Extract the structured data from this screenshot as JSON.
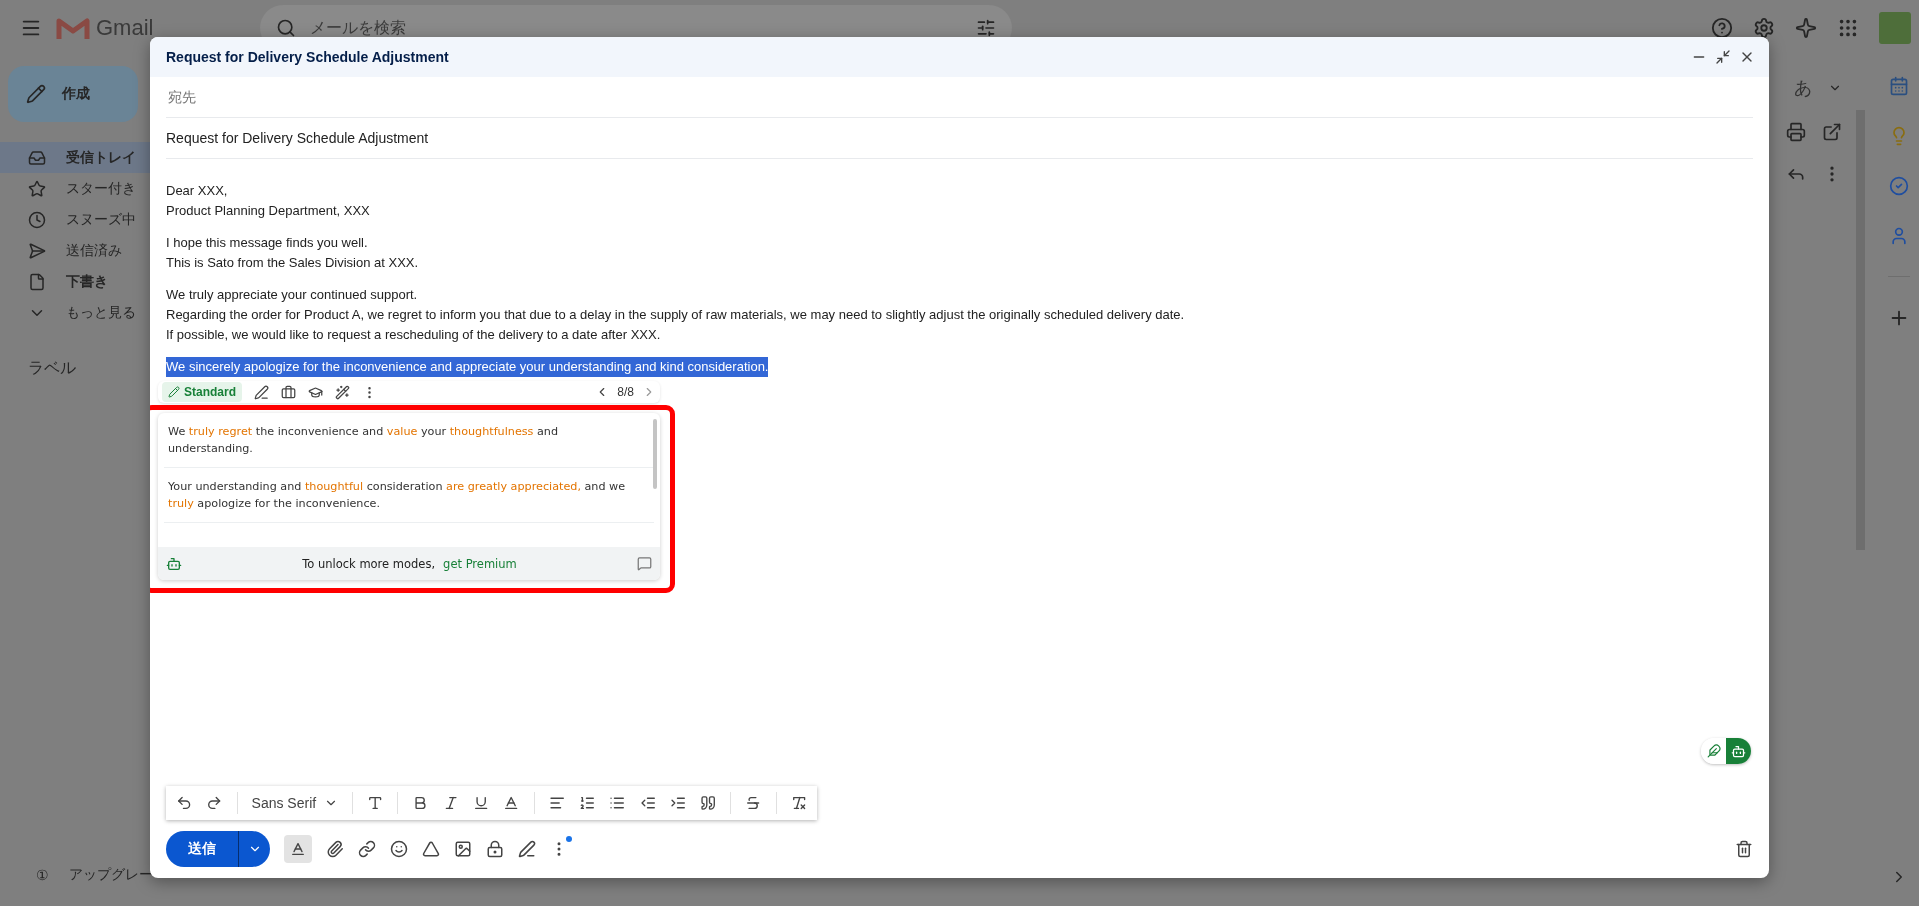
{
  "header": {
    "logo": "Gmail",
    "search": {
      "placeholder": "メールを検索"
    }
  },
  "sidebar": {
    "compose": "作成",
    "items": [
      {
        "label": "受信トレイ",
        "selected": true,
        "bold": true
      },
      {
        "label": "スター付き",
        "selected": false,
        "bold": false
      },
      {
        "label": "スヌーズ中",
        "selected": false,
        "bold": false
      },
      {
        "label": "送信済み",
        "selected": false,
        "bold": false
      },
      {
        "label": "下書き",
        "selected": false,
        "bold": true
      },
      {
        "label": "もっと見る",
        "selected": false,
        "bold": false
      }
    ],
    "labels_heading": "ラベル",
    "upgrade": {
      "mark": "①",
      "label": "アップグレー"
    }
  },
  "main": {
    "input_mode": "あ"
  },
  "compose": {
    "title": "Request for Delivery Schedule Adjustment",
    "to": {
      "placeholder": "宛先"
    },
    "subject": "Request for Delivery Schedule Adjustment",
    "body": [
      {
        "lines": [
          "Dear XXX,",
          "Product Planning Department, XXX"
        ],
        "selected": false
      },
      {
        "lines": [
          "I hope this message finds you well.",
          "This is Sato from the Sales Division at XXX."
        ],
        "selected": false
      },
      {
        "lines": [
          "We truly appreciate your continued support.",
          "Regarding the order for Product A, we regret to inform you that due to a delay in the supply of raw materials, we may need to slightly adjust the originally scheduled delivery date.",
          "If possible, we would like to request a rescheduling of the delivery to a date after XXX."
        ],
        "selected": false
      },
      {
        "lines": [
          "We sincerely apologize for the inconvenience and appreciate your understanding and kind consideration."
        ],
        "selected": true
      }
    ],
    "assistant": {
      "modes": [
        {
          "label": "Standard",
          "selected": true
        }
      ],
      "page": "8/8",
      "suggestions": [
        {
          "segments": [
            {
              "text": "We ",
              "changed": false
            },
            {
              "text": "truly regret",
              "changed": true
            },
            {
              "text": " the inconvenience and ",
              "changed": false
            },
            {
              "text": "value",
              "changed": true
            },
            {
              "text": " your ",
              "changed": false
            },
            {
              "text": "thoughtfulness",
              "changed": true
            },
            {
              "text": " and understanding.",
              "changed": false
            }
          ]
        },
        {
          "segments": [
            {
              "text": "Your understanding and ",
              "changed": false
            },
            {
              "text": "thoughtful",
              "changed": true
            },
            {
              "text": " consideration ",
              "changed": false
            },
            {
              "text": "are greatly appreciated,",
              "changed": true
            },
            {
              "text": " and we ",
              "changed": false
            },
            {
              "text": "truly",
              "changed": true
            },
            {
              "text": " apologize for the inconvenience.",
              "changed": false
            }
          ]
        }
      ],
      "footer": {
        "text": "To unlock more modes,",
        "link": "get Premium"
      }
    },
    "formatting": {
      "on": true,
      "font": "Sans Serif"
    },
    "assistant_toggle": {
      "on": true
    },
    "send": "送信"
  }
}
